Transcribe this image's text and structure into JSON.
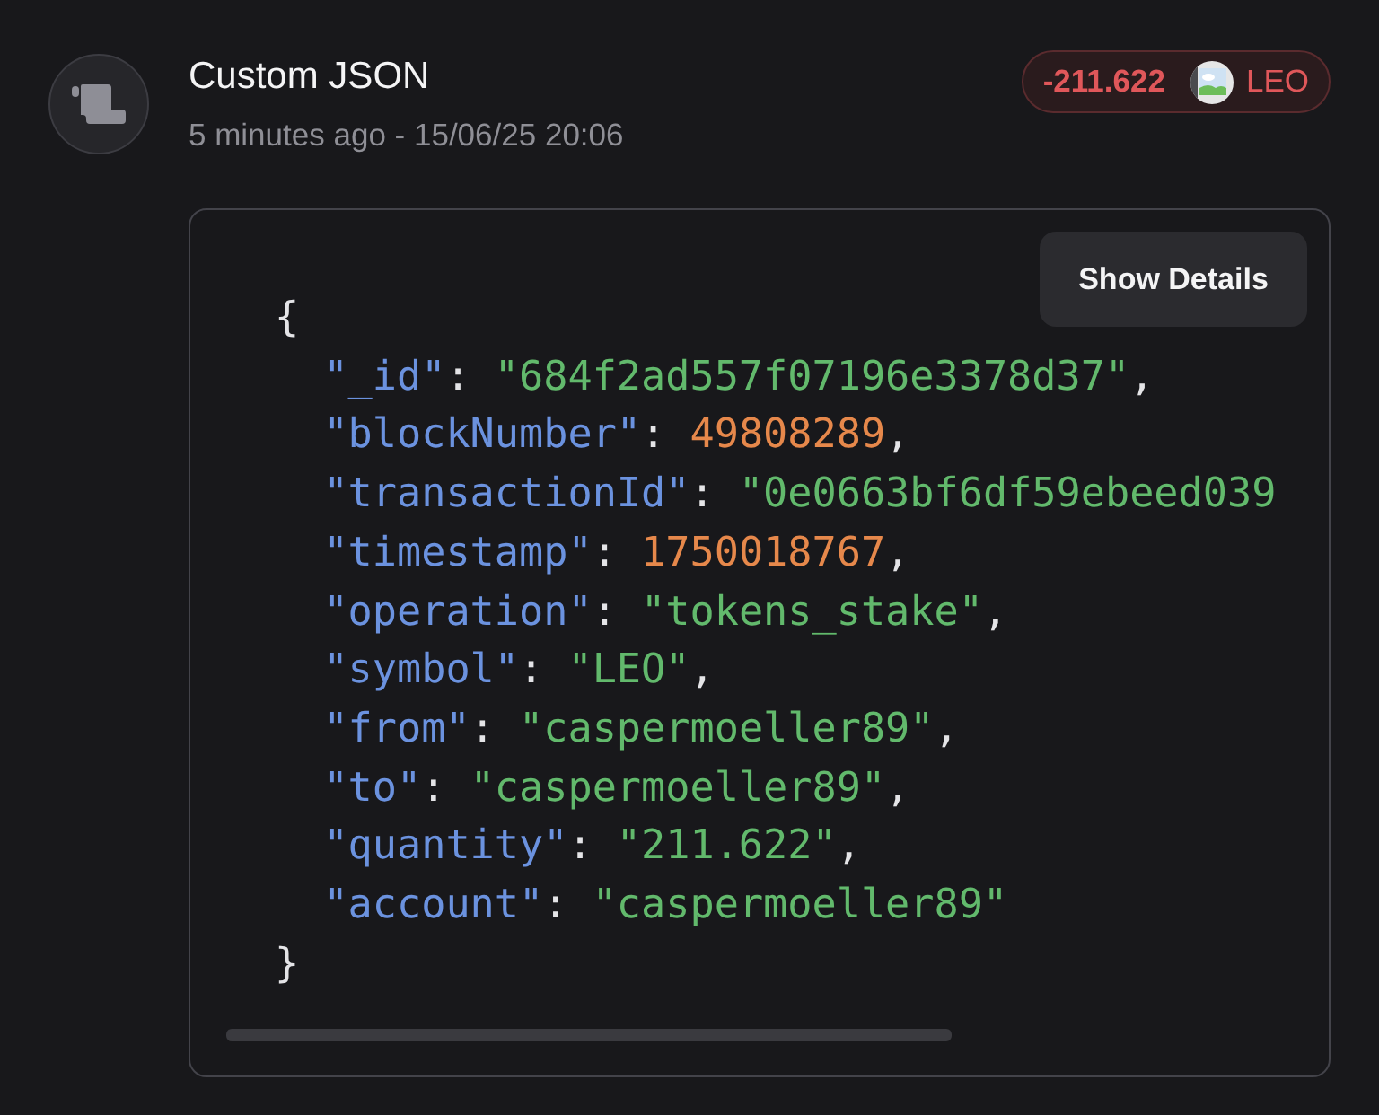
{
  "activity": {
    "title": "Custom JSON",
    "time": "5 minutes ago - 15/06/25 20:06"
  },
  "amount_badge": {
    "amount": "-211.622",
    "symbol": "LEO"
  },
  "details_card": {
    "button": "Show Details",
    "code": {
      "open": "{",
      "close": "}",
      "entries": [
        {
          "key": "\"_id\"",
          "colon": ":",
          "kind": "string",
          "value": "\"684f2ad557f07196e3378d37\"",
          "comma": ","
        },
        {
          "key": "\"blockNumber\"",
          "colon": ":",
          "kind": "number",
          "value": "49808289",
          "comma": ","
        },
        {
          "key": "\"transactionId\"",
          "colon": ":",
          "kind": "string",
          "value": "\"0e0663bf6df59ebeed039"
        },
        {
          "key": "\"timestamp\"",
          "colon": ":",
          "kind": "number",
          "value": "1750018767",
          "comma": ","
        },
        {
          "key": "\"operation\"",
          "colon": ":",
          "kind": "string",
          "value": "\"tokens_stake\"",
          "comma": ","
        },
        {
          "key": "\"symbol\"",
          "colon": ":",
          "kind": "string",
          "value": "\"LEO\"",
          "comma": ","
        },
        {
          "key": "\"from\"",
          "colon": ":",
          "kind": "string",
          "value": "\"caspermoeller89\"",
          "comma": ","
        },
        {
          "key": "\"to\"",
          "colon": ":",
          "kind": "string",
          "value": "\"caspermoeller89\"",
          "comma": ","
        },
        {
          "key": "\"quantity\"",
          "colon": ":",
          "kind": "string",
          "value": "\"211.622\"",
          "comma": ","
        },
        {
          "key": "\"account\"",
          "colon": ":",
          "kind": "string",
          "value": "\"caspermoeller89\""
        }
      ]
    }
  }
}
